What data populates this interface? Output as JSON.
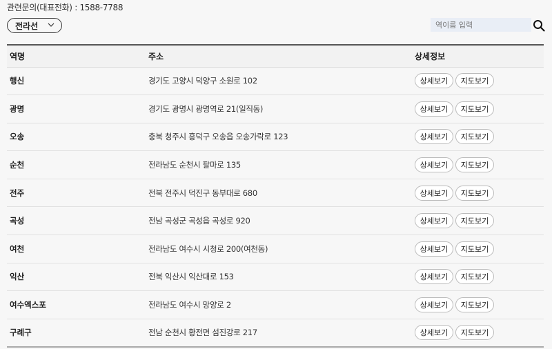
{
  "header": {
    "contact": "관련문의(대표전화) : 1588-7788"
  },
  "filter": {
    "selected_line": "전라선",
    "search_placeholder": "역이름 입력"
  },
  "table": {
    "columns": [
      "역명",
      "주소",
      "상세정보"
    ],
    "detail_label": "상세보기",
    "map_label": "지도보기",
    "rows": [
      {
        "name": "행신",
        "address": "경기도 고양시 덕양구 소원로 102"
      },
      {
        "name": "광명",
        "address": "경기도 광명시 광명역로 21(일직동)"
      },
      {
        "name": "오송",
        "address": "충북 청주시 흥덕구 오송읍 오송가락로 123"
      },
      {
        "name": "순천",
        "address": "전라남도 순천시 팔마로 135"
      },
      {
        "name": "전주",
        "address": "전북 전주시 덕진구 동부대로 680"
      },
      {
        "name": "곡성",
        "address": "전남 곡성군 곡성읍 곡성로 920"
      },
      {
        "name": "여천",
        "address": "전라남도 여수시 시청로 200(여천동)"
      },
      {
        "name": "익산",
        "address": "전북 익산시 익산대로 153"
      },
      {
        "name": "여수엑스포",
        "address": "전라남도 여수시 망양로 2"
      },
      {
        "name": "구례구",
        "address": "전남 순천시 황전면 섬진강로 217"
      }
    ]
  }
}
